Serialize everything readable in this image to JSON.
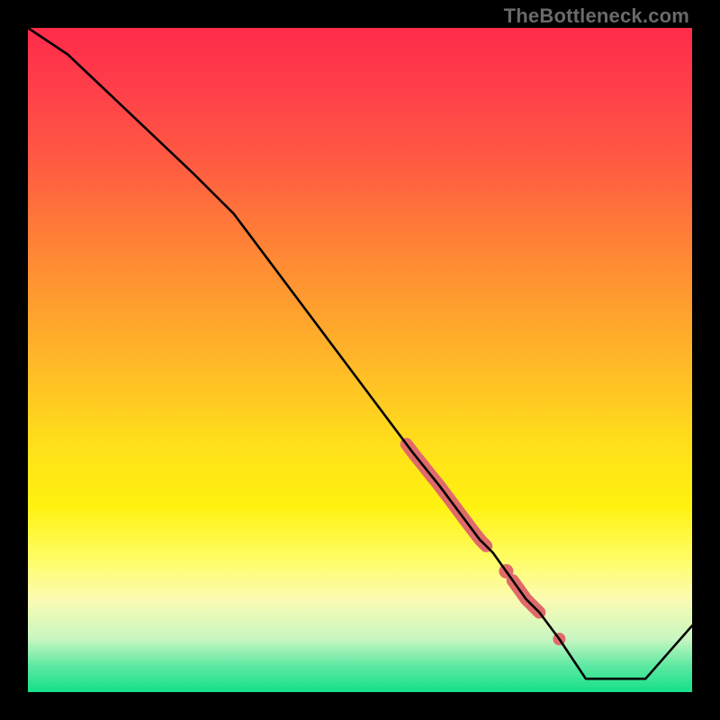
{
  "watermark": "TheBottleneck.com",
  "chart_data": {
    "type": "line",
    "title": "",
    "xlabel": "",
    "ylabel": "",
    "xlim": [
      0,
      100
    ],
    "ylim": [
      0,
      100
    ],
    "grid": false,
    "series": [
      {
        "name": "bottleneck-curve",
        "color": "#000000",
        "x": [
          0,
          6,
          25,
          31,
          58,
          62,
          68,
          70,
          75,
          77,
          80,
          84,
          93,
          100
        ],
        "values": [
          100,
          96,
          78,
          72,
          36,
          31,
          23,
          21,
          14,
          12,
          8,
          2,
          2,
          10
        ]
      }
    ],
    "highlights": [
      {
        "name": "thick-segment-1",
        "x_start": 57,
        "x_end": 69,
        "color": "#e06a6a",
        "thickness": 14
      },
      {
        "name": "dot-1",
        "x": 72,
        "color": "#e06a6a",
        "radius": 8
      },
      {
        "name": "thick-segment-2",
        "x_start": 73,
        "x_end": 77,
        "color": "#e06a6a",
        "thickness": 14
      },
      {
        "name": "dot-2",
        "x": 80,
        "color": "#e06a6a",
        "radius": 7
      }
    ]
  }
}
